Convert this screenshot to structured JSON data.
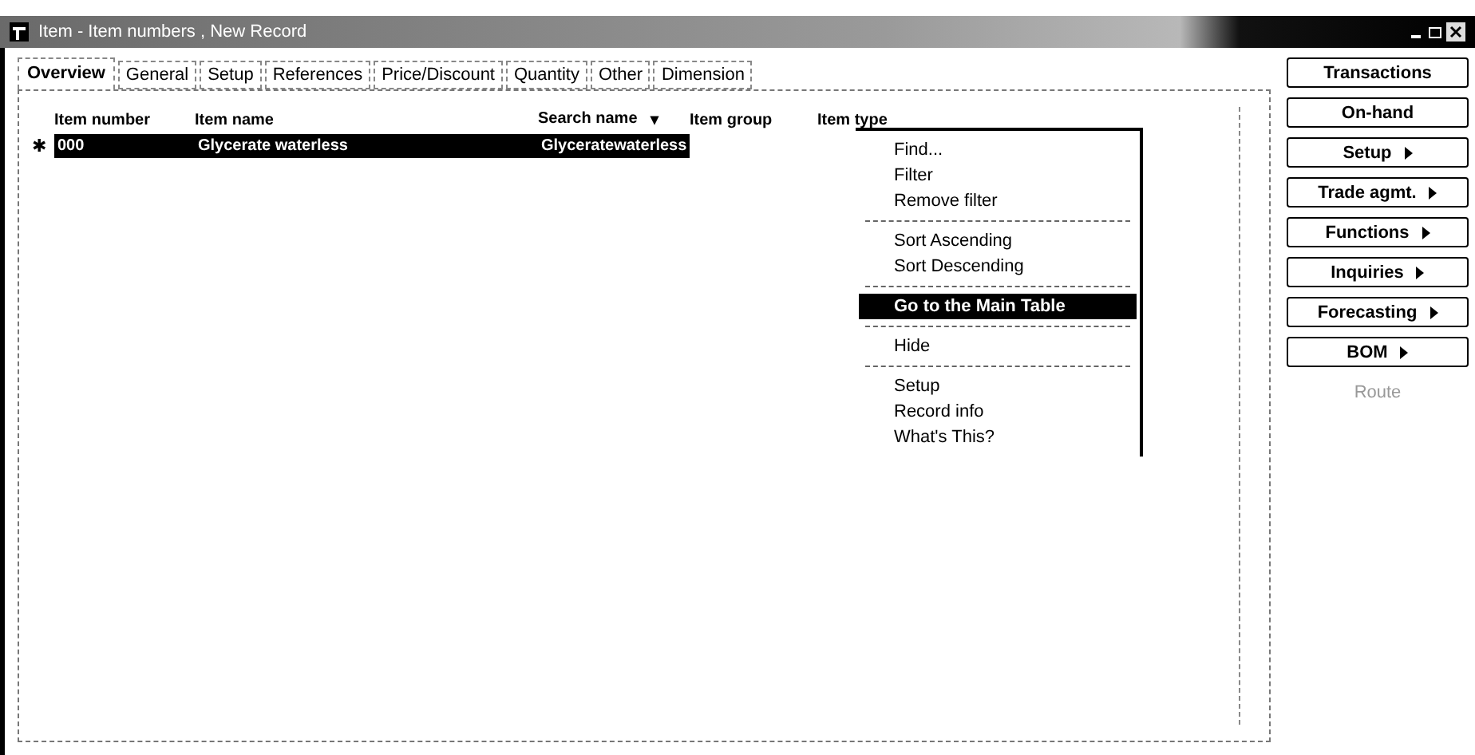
{
  "window": {
    "title": "Item - Item numbers , New Record"
  },
  "tabs": [
    {
      "label": "Overview",
      "selected": true
    },
    {
      "label": "General",
      "selected": false
    },
    {
      "label": "Setup",
      "selected": false
    },
    {
      "label": "References",
      "selected": false
    },
    {
      "label": "Price/Discount",
      "selected": false
    },
    {
      "label": "Quantity",
      "selected": false
    },
    {
      "label": "Other",
      "selected": false
    },
    {
      "label": "Dimension",
      "selected": false
    }
  ],
  "table": {
    "columns": [
      "Item number",
      "Item name",
      "Search name",
      "Item group",
      "Item type"
    ],
    "sort_marker": "▾",
    "new_row_marker": "✱",
    "rows": [
      {
        "cells": [
          "000",
          "Glycerate waterless",
          "Glyceratewaterless"
        ],
        "selected": true
      }
    ]
  },
  "context_menu": {
    "groups": [
      [
        {
          "label": "Find...",
          "selected": false
        },
        {
          "label": "Filter",
          "selected": false
        },
        {
          "label": "Remove filter",
          "selected": false
        }
      ],
      [
        {
          "label": "Sort Ascending",
          "selected": false
        },
        {
          "label": "Sort Descending",
          "selected": false
        }
      ],
      [
        {
          "label": "Go to the Main Table",
          "selected": true
        }
      ],
      [
        {
          "label": "Hide",
          "selected": false
        }
      ],
      [
        {
          "label": "Setup",
          "selected": false
        },
        {
          "label": "Record info",
          "selected": false
        },
        {
          "label": "What's This?",
          "selected": false
        }
      ]
    ]
  },
  "side_buttons": [
    {
      "label": "Transactions",
      "submenu": false,
      "disabled": false
    },
    {
      "label": "On-hand",
      "submenu": false,
      "disabled": false
    },
    {
      "label": "Setup",
      "submenu": true,
      "disabled": false
    },
    {
      "label": "Trade agmt.",
      "submenu": true,
      "disabled": false
    },
    {
      "label": "Functions",
      "submenu": true,
      "disabled": false
    },
    {
      "label": "Inquiries",
      "submenu": true,
      "disabled": false
    },
    {
      "label": "Forecasting",
      "submenu": true,
      "disabled": false
    },
    {
      "label": "BOM",
      "submenu": true,
      "disabled": false
    },
    {
      "label": "Route",
      "submenu": false,
      "disabled": true
    }
  ]
}
